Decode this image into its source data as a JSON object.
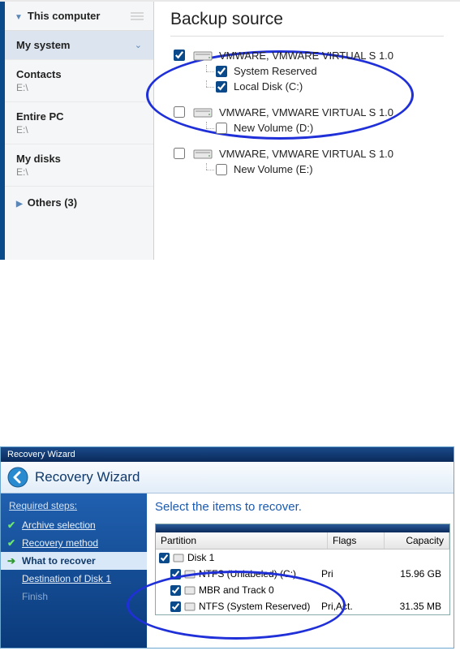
{
  "sidebar": {
    "header": "This computer",
    "items": [
      {
        "label": "My system",
        "sub": ""
      },
      {
        "label": "Contacts",
        "sub": "E:\\"
      },
      {
        "label": "Entire PC",
        "sub": "E:\\"
      },
      {
        "label": "My disks",
        "sub": "E:\\"
      }
    ],
    "others": "Others (3)"
  },
  "main": {
    "title": "Backup source",
    "disks": [
      {
        "name": "VMWARE, VMWARE VIRTUAL S 1.0",
        "checked": true,
        "vols": [
          {
            "name": "System Reserved",
            "checked": true
          },
          {
            "name": "Local Disk (C:)",
            "checked": true
          }
        ]
      },
      {
        "name": "VMWARE, VMWARE VIRTUAL S 1.0",
        "checked": false,
        "vols": [
          {
            "name": "New Volume (D:)",
            "checked": false
          }
        ]
      },
      {
        "name": "VMWARE, VMWARE VIRTUAL S 1.0",
        "checked": false,
        "vols": [
          {
            "name": "New Volume (E:)",
            "checked": false
          }
        ]
      }
    ]
  },
  "wizard": {
    "titlebar": "Recovery Wizard",
    "header": "Recovery Wizard",
    "steps_title": "Required steps:",
    "steps": [
      {
        "label": "Archive selection",
        "state": "done"
      },
      {
        "label": "Recovery method",
        "state": "done"
      },
      {
        "label": "What to recover",
        "state": "current"
      },
      {
        "label": "Destination of Disk 1",
        "state": "pending"
      },
      {
        "label": "Finish",
        "state": "disabled"
      }
    ],
    "heading": "Select the items to recover.",
    "cols": {
      "partition": "Partition",
      "flags": "Flags",
      "capacity": "Capacity"
    },
    "disk": {
      "name": "Disk 1",
      "checked": true,
      "parts": [
        {
          "name": "NTFS (Unlabeled) (C:)",
          "flags": "Pri",
          "cap": "15.96 GB",
          "checked": true
        },
        {
          "name": "MBR and Track 0",
          "flags": "",
          "cap": "",
          "checked": true
        },
        {
          "name": "NTFS (System Reserved)",
          "flags": "Pri,Act.",
          "cap": "31.35 MB",
          "checked": true
        }
      ]
    }
  }
}
